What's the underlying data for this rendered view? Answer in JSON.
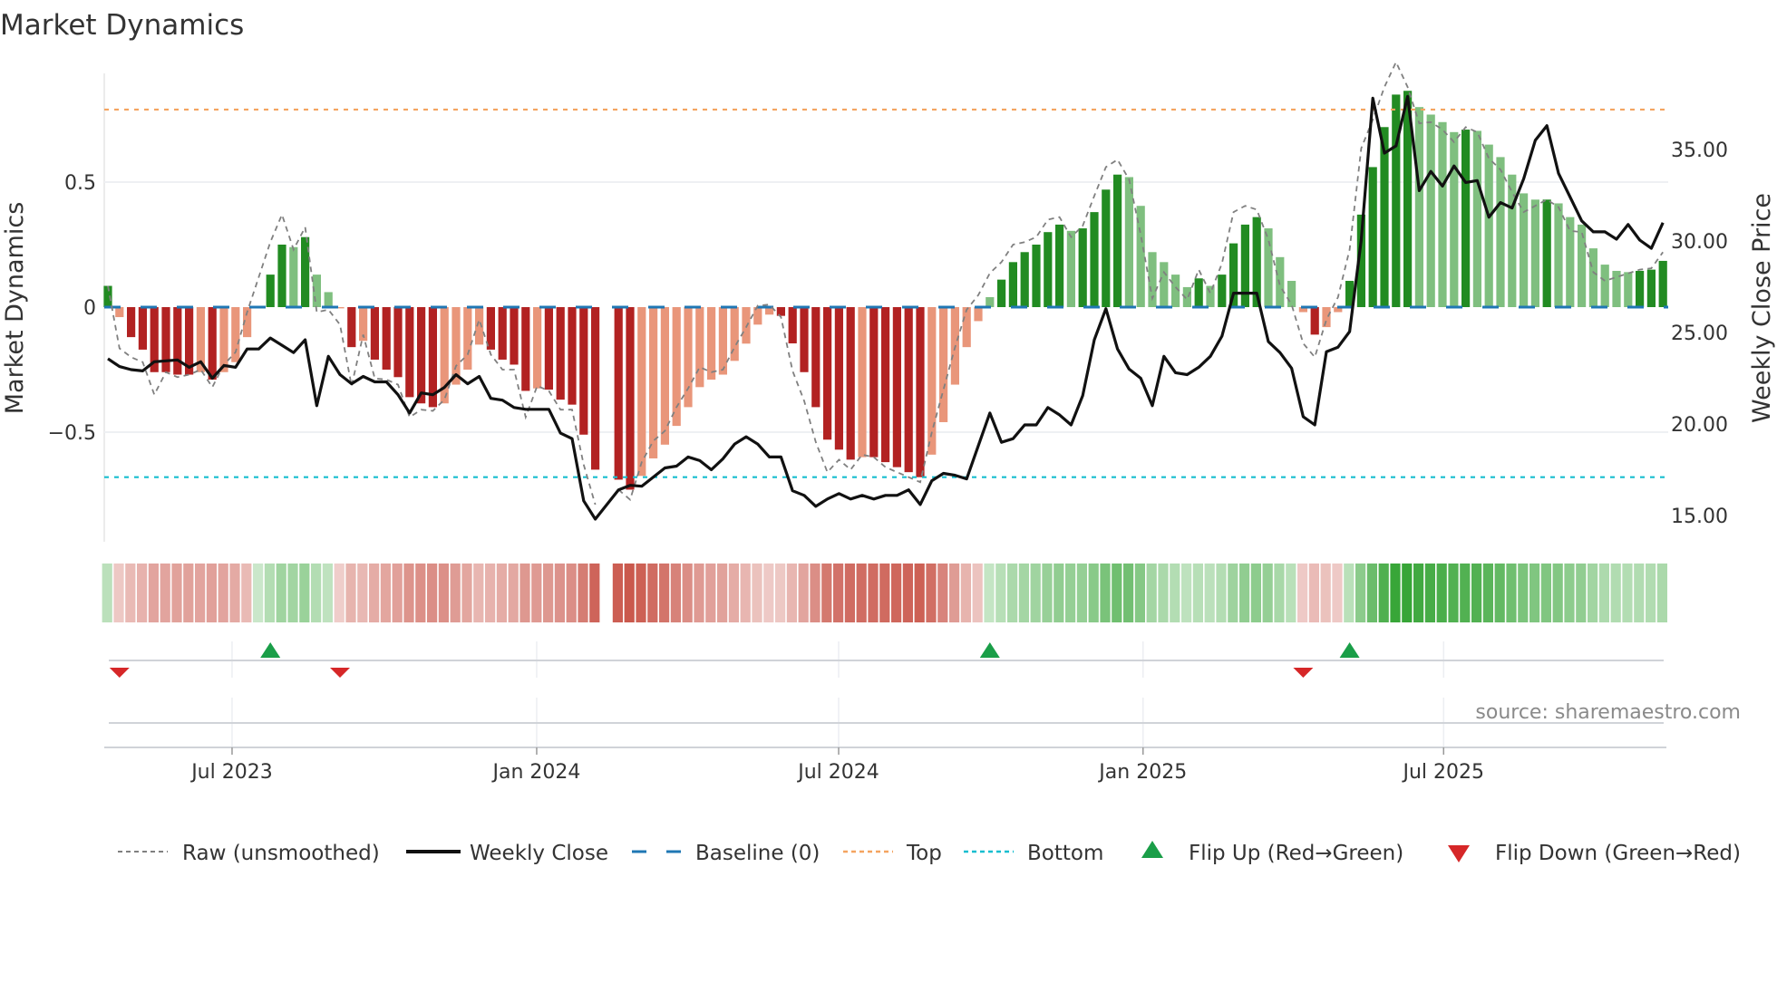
{
  "chart_data": {
    "type": "bar",
    "title": "Market Dynamics",
    "ylabel": "Market Dynamics",
    "y2label": "Weekly Close Price",
    "ylim": [
      -0.95,
      0.94
    ],
    "y2lim": [
      13.5,
      41
    ],
    "yticks": [
      {
        "v": 0.5,
        "label": "0.5"
      },
      {
        "v": 0,
        "label": "0"
      },
      {
        "v": -0.5,
        "label": "−0.5"
      }
    ],
    "y2ticks": [
      {
        "v": 35,
        "label": "35.00"
      },
      {
        "v": 30,
        "label": "30.00"
      },
      {
        "v": 25,
        "label": "25.00"
      },
      {
        "v": 20,
        "label": "20.00"
      },
      {
        "v": 15,
        "label": "15.00"
      }
    ],
    "xticks": [
      {
        "week": 11.7,
        "label": "Jul 2023"
      },
      {
        "week": 37.95,
        "label": "Jan 2024"
      },
      {
        "week": 63.97,
        "label": "Jul 2024"
      },
      {
        "week": 90.2,
        "label": "Jan 2025"
      },
      {
        "week": 116.1,
        "label": "Jul 2025"
      }
    ],
    "top_level": 0.79,
    "bottom_level": -0.68,
    "baseline": 0,
    "momentum": [
      0.085,
      -0.04,
      -0.12,
      -0.17,
      -0.26,
      -0.26,
      -0.27,
      -0.27,
      -0.26,
      -0.29,
      -0.26,
      -0.22,
      -0.12,
      0.0,
      0.13,
      0.25,
      0.24,
      0.28,
      0.13,
      0.06,
      -0.005,
      -0.16,
      -0.135,
      -0.21,
      -0.25,
      -0.28,
      -0.36,
      -0.385,
      -0.4,
      -0.385,
      -0.31,
      -0.25,
      -0.15,
      -0.17,
      -0.21,
      -0.23,
      -0.335,
      -0.325,
      -0.33,
      -0.37,
      -0.39,
      -0.51,
      -0.65,
      null,
      -0.69,
      -0.73,
      -0.675,
      -0.605,
      -0.55,
      -0.475,
      -0.4,
      -0.32,
      -0.29,
      -0.27,
      -0.215,
      -0.146,
      -0.07,
      -0.03,
      -0.035,
      -0.145,
      -0.26,
      -0.4,
      -0.53,
      -0.57,
      -0.61,
      -0.6,
      -0.6,
      -0.62,
      -0.64,
      -0.66,
      -0.68,
      -0.59,
      -0.46,
      -0.31,
      -0.16,
      -0.056,
      0.04,
      0.11,
      0.18,
      0.22,
      0.25,
      0.3,
      0.33,
      0.305,
      0.315,
      0.38,
      0.47,
      0.53,
      0.52,
      0.405,
      0.22,
      0.18,
      0.13,
      0.08,
      0.115,
      0.085,
      0.13,
      0.255,
      0.33,
      0.36,
      0.315,
      0.2,
      0.105,
      -0.02,
      -0.11,
      -0.08,
      -0.02,
      0.105,
      0.37,
      0.56,
      0.72,
      0.85,
      0.865,
      0.8,
      0.77,
      0.74,
      0.7,
      0.71,
      0.705,
      0.65,
      0.6,
      0.53,
      0.455,
      0.43,
      0.43,
      0.415,
      0.36,
      0.33,
      0.235,
      0.17,
      0.145,
      0.14,
      0.145,
      0.15,
      0.185
    ],
    "raw": [
      0.085,
      -0.165,
      -0.2,
      -0.22,
      -0.35,
      -0.26,
      -0.28,
      -0.27,
      -0.25,
      -0.32,
      -0.23,
      -0.18,
      -0.02,
      0.12,
      0.26,
      0.37,
      0.23,
      0.32,
      -0.02,
      -0.01,
      -0.07,
      -0.315,
      -0.11,
      -0.285,
      -0.29,
      -0.31,
      -0.44,
      -0.41,
      -0.415,
      -0.37,
      -0.235,
      -0.19,
      -0.05,
      -0.19,
      -0.25,
      -0.25,
      -0.44,
      -0.315,
      -0.335,
      -0.41,
      -0.41,
      -0.63,
      -0.79,
      null,
      -0.73,
      -0.77,
      -0.62,
      -0.535,
      -0.495,
      -0.4,
      -0.325,
      -0.24,
      -0.26,
      -0.25,
      -0.16,
      -0.08,
      0.006,
      0.01,
      -0.04,
      -0.255,
      -0.375,
      -0.54,
      -0.66,
      -0.61,
      -0.65,
      -0.59,
      -0.6,
      -0.64,
      -0.66,
      -0.68,
      -0.7,
      -0.5,
      -0.33,
      -0.16,
      -0.01,
      0.048,
      0.136,
      0.18,
      0.25,
      0.26,
      0.28,
      0.35,
      0.36,
      0.28,
      0.325,
      0.445,
      0.56,
      0.59,
      0.51,
      0.29,
      0.035,
      0.14,
      0.08,
      0.03,
      0.15,
      0.055,
      0.175,
      0.38,
      0.405,
      0.39,
      0.27,
      0.085,
      0.01,
      -0.145,
      -0.2,
      -0.05,
      0.04,
      0.23,
      0.635,
      0.75,
      0.88,
      0.98,
      0.88,
      0.735,
      0.74,
      0.71,
      0.66,
      0.72,
      0.7,
      0.595,
      0.55,
      0.46,
      0.38,
      0.405,
      0.43,
      0.4,
      0.305,
      0.3,
      0.14,
      0.105,
      0.12,
      0.135,
      0.15,
      0.155,
      0.22
    ],
    "close": [
      23.57,
      23.14,
      22.97,
      22.9,
      23.4,
      23.45,
      23.5,
      23.1,
      23.4,
      22.5,
      23.2,
      23.1,
      24.1,
      24.1,
      24.7,
      24.3,
      23.9,
      24.6,
      21.0,
      23.7,
      22.7,
      22.2,
      22.6,
      22.3,
      22.3,
      21.6,
      20.6,
      21.7,
      21.6,
      22.0,
      22.7,
      22.2,
      22.6,
      21.4,
      21.3,
      20.9,
      20.8,
      20.8,
      20.8,
      19.5,
      19.2,
      15.8,
      14.8,
      15.6,
      16.4,
      16.65,
      16.6,
      17.1,
      17.6,
      17.7,
      18.2,
      18.0,
      17.5,
      18.1,
      18.9,
      19.3,
      18.9,
      18.2,
      18.2,
      16.35,
      16.1,
      15.5,
      15.9,
      16.2,
      15.9,
      16.1,
      15.9,
      16.1,
      16.1,
      16.4,
      15.6,
      16.9,
      17.3,
      17.2,
      17.0,
      18.8,
      20.6,
      19.0,
      19.2,
      19.95,
      19.95,
      20.9,
      20.5,
      19.95,
      21.55,
      24.6,
      26.3,
      24.1,
      23.0,
      22.5,
      21.0,
      23.7,
      22.8,
      22.7,
      23.1,
      23.7,
      24.8,
      27.15,
      27.15,
      27.15,
      24.5,
      23.9,
      23.05,
      20.4,
      19.95,
      23.95,
      24.2,
      25.05,
      30.05,
      37.8,
      34.8,
      35.2,
      37.9,
      32.75,
      33.8,
      33.0,
      34.1,
      33.2,
      33.3,
      31.3,
      32.1,
      31.8,
      33.4,
      35.5,
      36.3,
      33.7,
      32.4,
      31.1,
      30.5,
      30.5,
      30.1,
      30.9,
      30.05,
      29.6,
      31.0
    ],
    "flip_up_weeks": [
      15,
      77,
      108
    ],
    "flip_down_weeks": [
      2,
      21,
      104
    ],
    "legend": [
      {
        "key": "raw",
        "label": "Raw (unsmoothed)"
      },
      {
        "key": "close",
        "label": "Weekly Close"
      },
      {
        "key": "baseline",
        "label": "Baseline (0)"
      },
      {
        "key": "top",
        "label": "Top"
      },
      {
        "key": "bottom",
        "label": "Bottom"
      },
      {
        "key": "flipup",
        "label": "Flip Up (Red→Green)"
      },
      {
        "key": "flipdown",
        "label": "Flip Down (Green→Red)"
      }
    ],
    "legend_placement": "bottom",
    "grid": true
  },
  "source": "source: sharemaestro.com",
  "colors": {
    "green_strong": "#228b22",
    "green_weak": "#7fbf7f",
    "red_strong": "#b22222",
    "red_weak": "#e9967a",
    "baseline": "#1f77b4",
    "top": "#f4a460",
    "bottom": "#17becf",
    "raw": "#808080",
    "close": "#111111",
    "flip_up": "#1a9e48",
    "flip_down": "#d62728",
    "heat_green": "#2ca02c",
    "heat_red": "#c0392b"
  }
}
